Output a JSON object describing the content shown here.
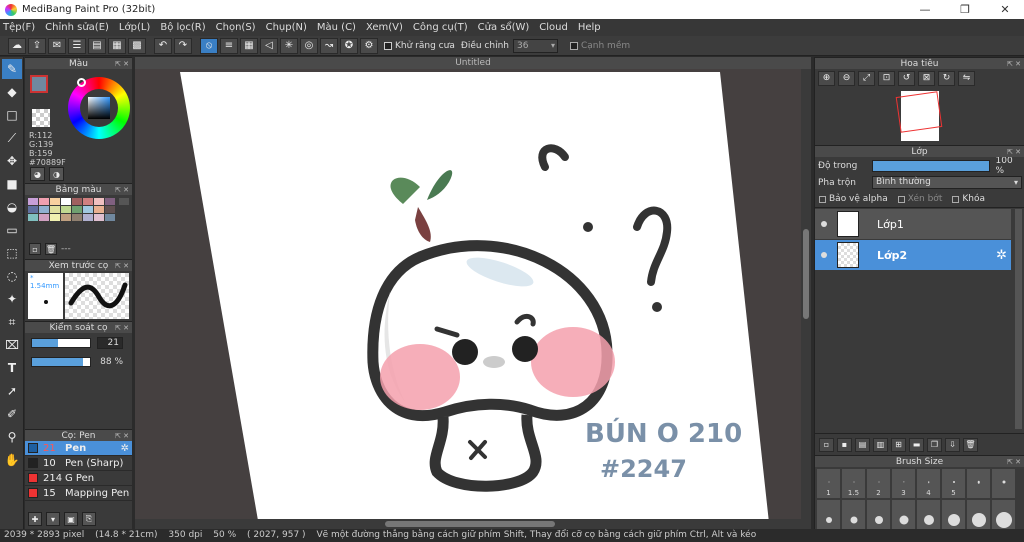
{
  "window": {
    "title": "MediBang Paint Pro (32bit)",
    "min": "—",
    "max": "❐",
    "close": "✕"
  },
  "menu": [
    "Tệp(F)",
    "Chỉnh sửa(E)",
    "Lớp(L)",
    "Bộ lọc(R)",
    "Chọn(S)",
    "Chụp(N)",
    "Màu (C)",
    "Xem(V)",
    "Công cụ(T)",
    "Cửa sổ(W)",
    "Cloud",
    "Help"
  ],
  "toolbar": {
    "antialias_label": "Khử răng cưa",
    "correction_label": "Điều chỉnh",
    "correction_value": "36",
    "smooth_label": "Cạnh mềm"
  },
  "color_panel": {
    "title": "Màu",
    "rgb": "R:112\nG:139\nB:159\n#70889F",
    "fg_color": "#70889F"
  },
  "palette_panel": {
    "title": "Bảng màu",
    "row_text": "---",
    "colors": [
      "#c8a0d8",
      "#f0a0b0",
      "#f8d0a0",
      "#ffffff",
      "#a06060",
      "#d08080",
      "#f0c0c0",
      "#806080",
      "#6070a0",
      "#90b0d0",
      "#e0e0a0",
      "#c0d890",
      "#70a070",
      "#a0c8e0",
      "#e8b090",
      "#605050",
      "#80c0c0",
      "#d0a0c0",
      "#f0f0b0",
      "#c0a080",
      "#908070",
      "#b0b0d0",
      "#e0c0d0",
      "#70889F"
    ]
  },
  "preview_panel": {
    "title": "Xem trước cọ",
    "size": "* 1.54mm"
  },
  "control_panel": {
    "title": "Kiểm soát cọ",
    "size_value": "21",
    "size_fill": 0.45,
    "opacity_value": "88 %",
    "opacity_fill": 0.88
  },
  "brush_panel": {
    "title": "Cọ: Pen",
    "items": [
      {
        "num": "21",
        "name": "Pen",
        "color": "#4a90d9",
        "selected": true
      },
      {
        "num": "10",
        "name": "Pen (Sharp)",
        "color": "#222222",
        "selected": false
      },
      {
        "num": "214",
        "name": "G Pen",
        "color": "#e33333",
        "selected": false
      },
      {
        "num": "15",
        "name": "Mapping Pen",
        "color": "#e33333",
        "selected": false
      }
    ]
  },
  "canvas": {
    "tab": "Untitled",
    "signature": "BÚN O 210",
    "tag": "#2247"
  },
  "navigator": {
    "title": "Hoa tiêu"
  },
  "layer_panel": {
    "title": "Lớp",
    "opacity_label": "Độ trong",
    "opacity_value": "100 %",
    "blend_label": "Pha trộn",
    "blend_value": "Bình thường",
    "protect_alpha": "Bảo vệ alpha",
    "clip": "Xén bớt",
    "lock": "Khóa",
    "layers": [
      {
        "name": "Lớp1",
        "selected": false
      },
      {
        "name": "Lớp2",
        "selected": true
      }
    ]
  },
  "brush_size": {
    "title": "Brush Size",
    "labels": [
      "1",
      "1.5",
      "2",
      "3",
      "4",
      "5",
      "",
      ""
    ]
  },
  "status": {
    "dims": "2039 * 2893 pixel",
    "cm": "(14.8 * 21cm)",
    "dpi": "350 dpi",
    "zoom": "50 %",
    "coords": "( 2027, 957 )",
    "hint": "Vẽ một đường thẳng bằng cách giữ phím Shift, Thay đổi cỡ cọ bằng cách giữ phím Ctrl, Alt và kéo"
  }
}
